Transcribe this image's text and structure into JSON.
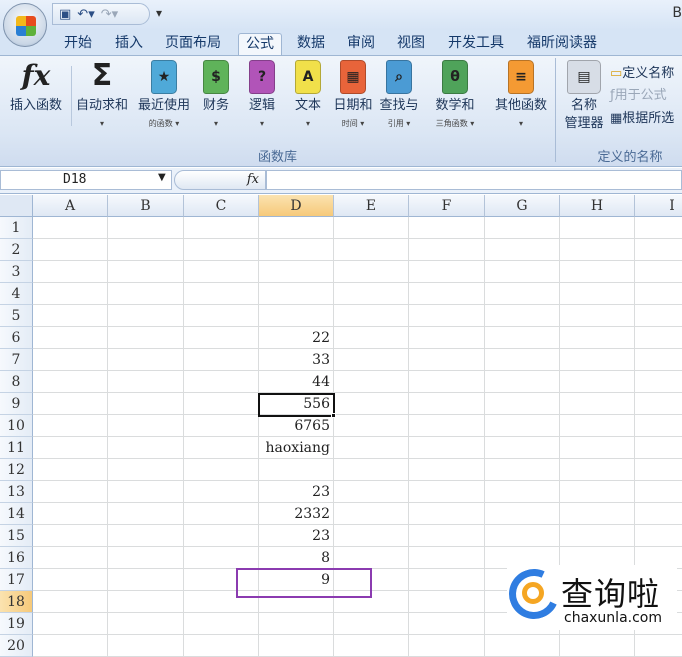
{
  "window": {
    "title": "B"
  },
  "qat": {
    "save_icon": "save-icon",
    "undo_icon": "undo-icon",
    "redo_icon": "redo-icon",
    "more": "▾"
  },
  "tabs": [
    "开始",
    "插入",
    "页面布局",
    "公式",
    "数据",
    "审阅",
    "视图",
    "开发工具",
    "福昕阅读器"
  ],
  "active_tab": "公式",
  "ribbon": {
    "function_library": {
      "label": "函数库",
      "buttons": [
        {
          "line1": "插入函数",
          "line2": "",
          "icon": "fx",
          "color": ""
        },
        {
          "line1": "自动求和",
          "line2": "▾",
          "icon": "Σ",
          "color": ""
        },
        {
          "line1": "最近使用",
          "line2": "的函数 ▾",
          "icon": "★",
          "color": "#4fa9d8"
        },
        {
          "line1": "财务",
          "line2": "▾",
          "icon": "$",
          "color": "#5fb35a"
        },
        {
          "line1": "逻辑",
          "line2": "▾",
          "icon": "?",
          "color": "#b154b8"
        },
        {
          "line1": "文本",
          "line2": "▾",
          "icon": "A",
          "color": "#f1e04a"
        },
        {
          "line1": "日期和",
          "line2": "时间 ▾",
          "icon": "▦",
          "color": "#e8643a"
        },
        {
          "line1": "查找与",
          "line2": "引用 ▾",
          "icon": "⌕",
          "color": "#4b9bd4"
        },
        {
          "line1": "数学和",
          "line2": "三角函数 ▾",
          "icon": "θ",
          "color": "#4fa35a"
        },
        {
          "line1": "其他函数",
          "line2": "▾",
          "icon": "≡",
          "color": "#f49a33"
        }
      ]
    },
    "defined_names": {
      "label": "定义的名称",
      "name_manager": {
        "line1": "名称",
        "line2": "管理器"
      },
      "define_name": "定义名称",
      "use_in_formula": "用于公式",
      "create_from_selection": "根据所选"
    }
  },
  "formula_bar": {
    "name_box": "D18",
    "fx": "fx",
    "value": ""
  },
  "sheet": {
    "columns": [
      "A",
      "B",
      "C",
      "D",
      "E",
      "F",
      "G",
      "H",
      "I"
    ],
    "selected_column": "D",
    "selected_row": 18,
    "rows": [
      1,
      2,
      3,
      4,
      5,
      6,
      7,
      8,
      9,
      10,
      11,
      12,
      13,
      14,
      15,
      16,
      17,
      18,
      19,
      20
    ],
    "column_d_values": {
      "6": "22",
      "7": "33",
      "8": "44",
      "9": "556",
      "10": "6765",
      "11": "haoxiang",
      "13": "23",
      "14": "2332",
      "15": "23",
      "16": "8",
      "17": "9"
    },
    "highlight_color": "#8b3bb0"
  },
  "watermark": {
    "cn": "查询啦",
    "en": "chaxunla.com"
  }
}
